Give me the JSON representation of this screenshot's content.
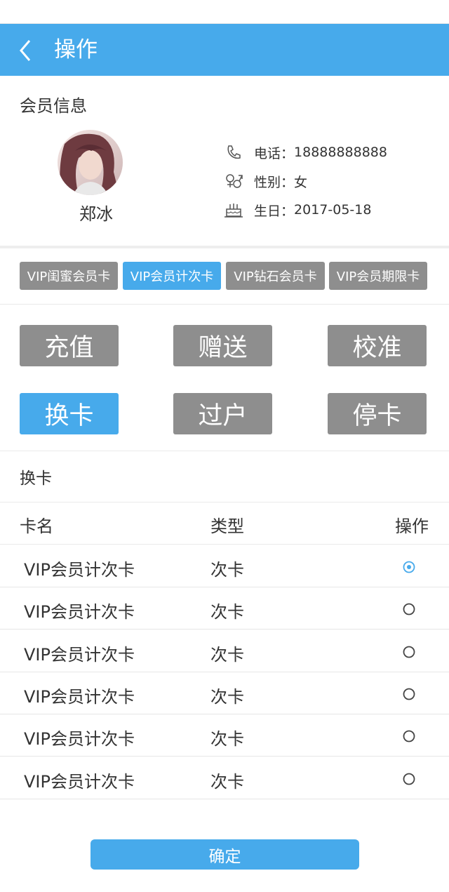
{
  "header": {
    "title": "操作"
  },
  "member_section": {
    "title": "会员信息"
  },
  "member": {
    "name": "郑冰",
    "phone_label": "电话：",
    "phone": "18888888888",
    "gender_label": "性别：",
    "gender": "女",
    "birthday_label": "生日：",
    "birthday": "2017-05-18"
  },
  "card_tabs": [
    {
      "label": "VIP闺蜜会员卡",
      "active": false
    },
    {
      "label": "VIP会员计次卡",
      "active": true
    },
    {
      "label": "VIP钻石会员卡",
      "active": false
    },
    {
      "label": "VIP会员期限卡",
      "active": false
    }
  ],
  "operations": [
    {
      "label": "充值",
      "active": false
    },
    {
      "label": "赠送",
      "active": false
    },
    {
      "label": "校准",
      "active": false
    },
    {
      "label": "换卡",
      "active": true
    },
    {
      "label": "过户",
      "active": false
    },
    {
      "label": "停卡",
      "active": false
    }
  ],
  "exchange": {
    "title": "换卡",
    "columns": [
      "卡名",
      "类型",
      "操作"
    ],
    "rows": [
      {
        "name": "VIP会员计次卡",
        "type": "次卡",
        "selected": true
      },
      {
        "name": "VIP会员计次卡",
        "type": "次卡",
        "selected": false
      },
      {
        "name": "VIP会员计次卡",
        "type": "次卡",
        "selected": false
      },
      {
        "name": "VIP会员计次卡",
        "type": "次卡",
        "selected": false
      },
      {
        "name": "VIP会员计次卡",
        "type": "次卡",
        "selected": false
      },
      {
        "name": "VIP会员计次卡",
        "type": "次卡",
        "selected": false
      }
    ]
  },
  "confirm_label": "确定",
  "colors": {
    "accent": "#47aaeb",
    "inactive": "#8e8e8e",
    "text": "#333333"
  }
}
